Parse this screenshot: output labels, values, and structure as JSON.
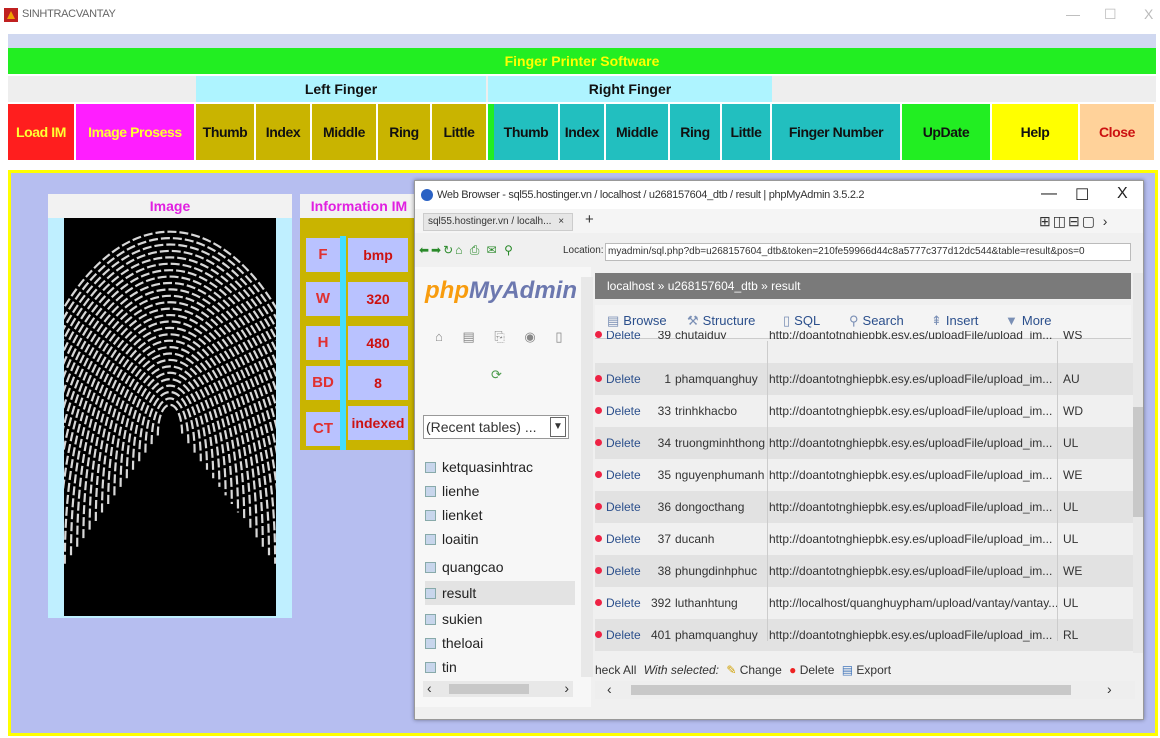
{
  "app": {
    "title": "SINHTRACVANTAY",
    "window_controls": [
      "—",
      "☐",
      "X"
    ]
  },
  "banner": "Finger Printer Software",
  "groups": {
    "left": "Left Finger",
    "right": "Right Finger"
  },
  "toolbar": {
    "load": "Load IM",
    "process": "Image Prosess",
    "left": [
      "Thumb",
      "Index",
      "Middle",
      "Ring",
      "Little"
    ],
    "right": [
      "Thumb",
      "Index",
      "Middle",
      "Ring",
      "Little"
    ],
    "finger_number": "Finger Number",
    "update": "UpDate",
    "help": "Help",
    "close": "Close"
  },
  "colors": {
    "banner_bg": "#22ee22",
    "banner_text": "#ffff00",
    "load_bg": "#ff1e1e",
    "process_bg": "#ff1eff",
    "left_btn_bg": "#c9b400",
    "right_btn_bg": "#22bfbf",
    "finger_number_bg": "#22bfbf",
    "update_bg": "#22ee22",
    "help_bg": "#ffff00",
    "close_bg": "#ffd29a",
    "main_bg": "#b6bef0"
  },
  "image_panel": {
    "header": "Image"
  },
  "info_panel": {
    "header": "Information IM",
    "rows": [
      {
        "key": "F",
        "value": "bmp"
      },
      {
        "key": "W",
        "value": "320"
      },
      {
        "key": "H",
        "value": "480"
      },
      {
        "key": "BD",
        "value": "8"
      },
      {
        "key": "CT",
        "value": "indexed"
      }
    ]
  },
  "browser": {
    "title": "Web Browser - sql55.hostinger.vn / localhost / u268157604_dtb / result | phpMyAdmin 3.5.2.2",
    "tab": "sql55.hostinger.vn / localh...",
    "tab_close": "×",
    "add_tab": "+",
    "location_label": "Location:",
    "location": "myadmin/sql.php?db=u268157604_dtb&token=210fe59966d44c8a5777c377d12dc544&table=result&pos=0",
    "controls": [
      "—",
      "☐",
      "X"
    ]
  },
  "pma": {
    "logo_php": "php",
    "logo_myadmin": "MyAdmin",
    "recent": "(Recent tables) ...",
    "tables": [
      "ketquasinhtrac",
      "lienhe",
      "lienket",
      "loaitin",
      "quangcao",
      "result",
      "sukien",
      "theloai",
      "tin"
    ],
    "selected_table": "result",
    "breadcrumb": "localhost » u268157604_dtb » result",
    "tabs": [
      "Browse",
      "Structure",
      "SQL",
      "Search",
      "Insert",
      "More"
    ],
    "rows": [
      {
        "action": "Delete",
        "id": "39",
        "name": "chutaiduy",
        "url": "http://doantotnghiepbk.esy.es/uploadFile/upload_im...",
        "code": "WS"
      },
      {
        "action": "Delete",
        "id": "1",
        "name": "phamquanghuy",
        "url": "http://doantotnghiepbk.esy.es/uploadFile/upload_im...",
        "code": "AU"
      },
      {
        "action": "Delete",
        "id": "33",
        "name": "trinhkhacbo",
        "url": "http://doantotnghiepbk.esy.es/uploadFile/upload_im...",
        "code": "WD"
      },
      {
        "action": "Delete",
        "id": "34",
        "name": "truongminhthong",
        "url": "http://doantotnghiepbk.esy.es/uploadFile/upload_im...",
        "code": "UL"
      },
      {
        "action": "Delete",
        "id": "35",
        "name": "nguyenphumanh",
        "url": "http://doantotnghiepbk.esy.es/uploadFile/upload_im...",
        "code": "WE"
      },
      {
        "action": "Delete",
        "id": "36",
        "name": "dongocthang",
        "url": "http://doantotnghiepbk.esy.es/uploadFile/upload_im...",
        "code": "UL"
      },
      {
        "action": "Delete",
        "id": "37",
        "name": "ducanh",
        "url": "http://doantotnghiepbk.esy.es/uploadFile/upload_im...",
        "code": "UL"
      },
      {
        "action": "Delete",
        "id": "38",
        "name": "phungdinhphuc",
        "url": "http://doantotnghiepbk.esy.es/uploadFile/upload_im...",
        "code": "WE"
      },
      {
        "action": "Delete",
        "id": "392",
        "name": "luthanhtung",
        "url": "http://localhost/quanghuypham/upload/vantay/vantay...",
        "code": "UL"
      },
      {
        "action": "Delete",
        "id": "401",
        "name": "phamquanghuy",
        "url": "http://doantotnghiepbk.esy.es/uploadFile/upload_im...",
        "code": "RL"
      }
    ],
    "bottom": {
      "check_all": "heck All",
      "with_selected": "With selected:",
      "change": "Change",
      "delete": "Delete",
      "export": "Export"
    }
  }
}
